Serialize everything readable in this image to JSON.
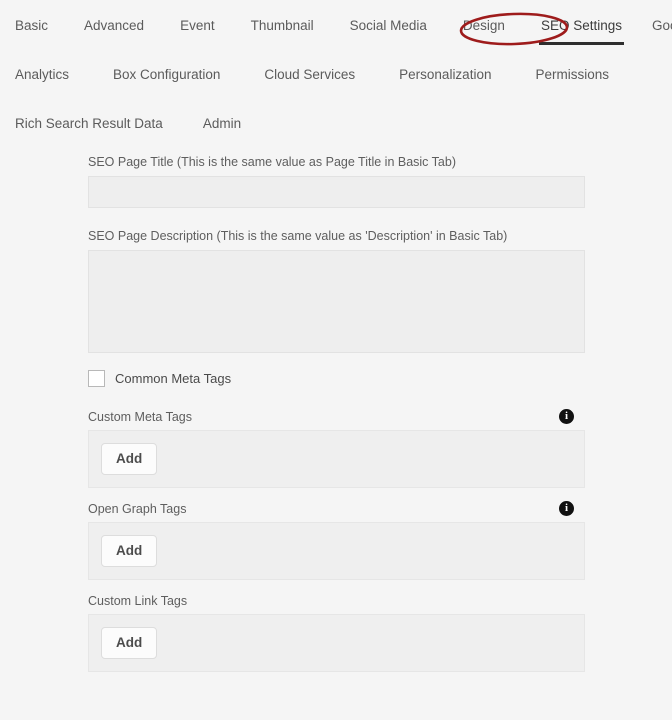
{
  "tabs": {
    "rows": [
      [
        {
          "label": "Basic",
          "active": false
        },
        {
          "label": "Advanced",
          "active": false
        },
        {
          "label": "Event",
          "active": false
        },
        {
          "label": "Thumbnail",
          "active": false
        },
        {
          "label": "Social Media",
          "active": false
        },
        {
          "label": "Design",
          "active": false
        },
        {
          "label": "SEO Settings",
          "active": true
        },
        {
          "label": "Google Settings",
          "active": false
        }
      ],
      [
        {
          "label": "Analytics",
          "active": false
        },
        {
          "label": "Box Configuration",
          "active": false
        },
        {
          "label": "Cloud Services",
          "active": false
        },
        {
          "label": "Personalization",
          "active": false
        },
        {
          "label": "Permissions",
          "active": false
        }
      ],
      [
        {
          "label": "Rich Search Result Data",
          "active": false
        },
        {
          "label": "Admin",
          "active": false
        }
      ]
    ]
  },
  "annotation": {
    "shape": "ellipse-highlight",
    "target": "SEO Settings",
    "color": "#9e1b1b"
  },
  "form": {
    "seo_title": {
      "label": "SEO Page Title (This is the same value as Page Title in Basic Tab)",
      "value": "",
      "placeholder": ""
    },
    "seo_description": {
      "label": "SEO Page Description (This is the same value as 'Description' in Basic Tab)",
      "value": "",
      "placeholder": ""
    },
    "common_meta_tags": {
      "label": "Common Meta Tags",
      "checked": false
    },
    "sections": [
      {
        "label": "Custom Meta Tags",
        "add_label": "Add",
        "info_icon": "info-icon",
        "has_info": true
      },
      {
        "label": "Open Graph Tags",
        "add_label": "Add",
        "info_icon": "info-icon",
        "has_info": true
      },
      {
        "label": "Custom Link Tags",
        "add_label": "Add",
        "info_icon": "",
        "has_info": false
      }
    ]
  },
  "colors": {
    "page_background": "#f5f5f5",
    "input_background": "#eeeeee",
    "panel_background": "#efefef",
    "annotation_red": "#9e1b1b",
    "active_tab_underline": "#2e2e2e",
    "text": "#555555"
  }
}
